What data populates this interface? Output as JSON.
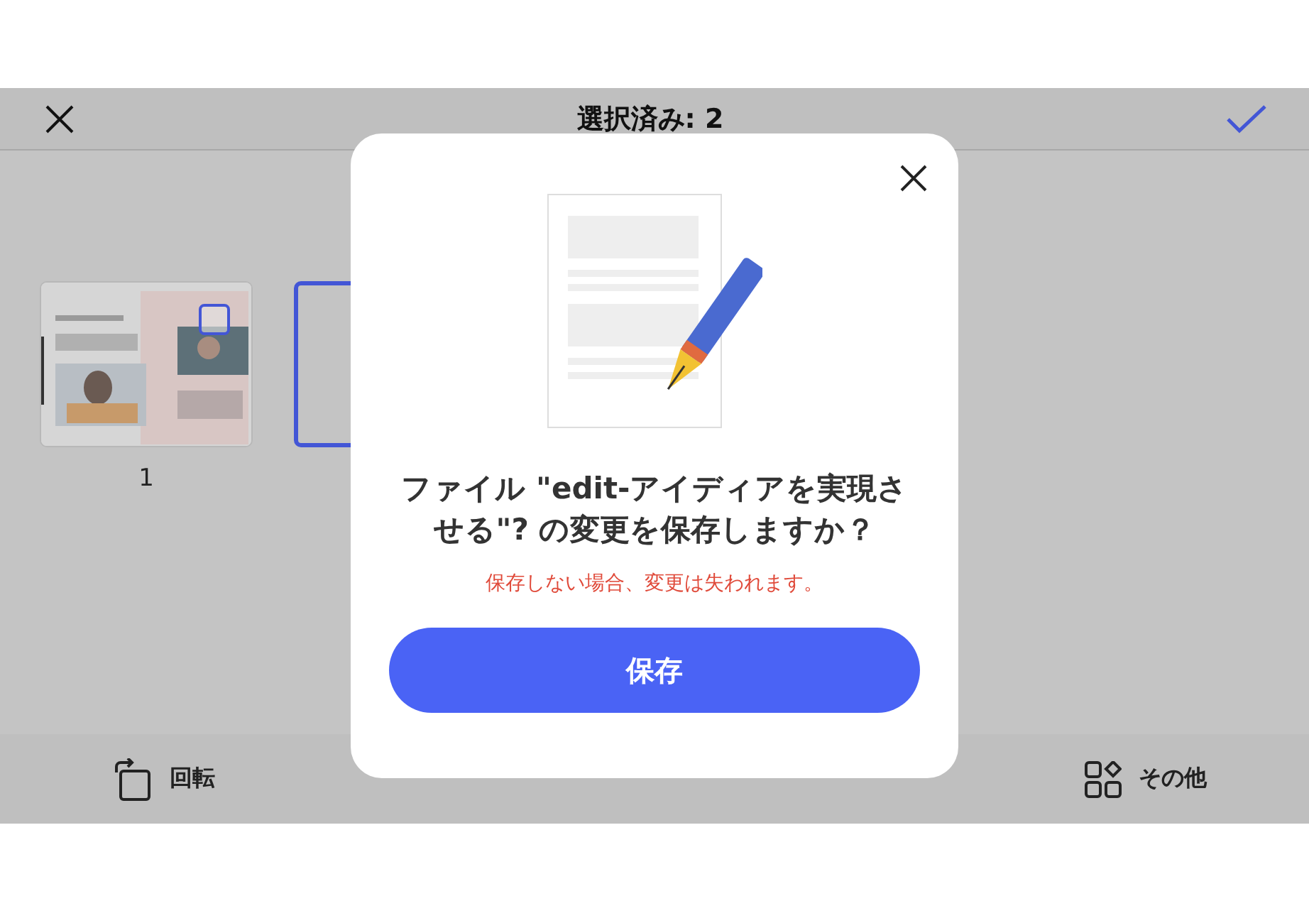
{
  "header": {
    "title": "選択済み: 2"
  },
  "pages": [
    {
      "label": "1",
      "selected": false
    },
    {
      "selected": true
    }
  ],
  "toolbar": [
    {
      "kind": "rotate",
      "label": "回転"
    },
    {
      "kind": "more",
      "label": "その他"
    }
  ],
  "dialog": {
    "title": "ファイル \"edit-アイディアを実現させる\"? の変更を保存しますか？",
    "warning": "保存しない場合、変更は失われます。",
    "button": "保存"
  }
}
